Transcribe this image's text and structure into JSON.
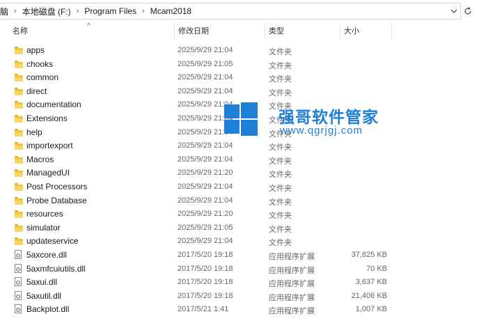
{
  "address_bar": {
    "crumbs": [
      "电脑",
      "本地磁盘 (F:)",
      "Program Files",
      "Mcam2018"
    ],
    "separator": "›",
    "dropdown_icon": "chevron-down-icon",
    "refresh_icon": "refresh-icon"
  },
  "columns": {
    "name": "名称",
    "date": "修改日期",
    "type": "类型",
    "size": "大小",
    "sort_indicator": "^"
  },
  "rows": [
    {
      "kind": "folder",
      "name": "apps",
      "date": "2025/9/29 21:04",
      "type": "文件夹",
      "size": ""
    },
    {
      "kind": "folder",
      "name": "chooks",
      "date": "2025/9/29 21:05",
      "type": "文件夹",
      "size": ""
    },
    {
      "kind": "folder",
      "name": "common",
      "date": "2025/9/29 21:04",
      "type": "文件夹",
      "size": ""
    },
    {
      "kind": "folder",
      "name": "direct",
      "date": "2025/9/29 21:04",
      "type": "文件夹",
      "size": ""
    },
    {
      "kind": "folder",
      "name": "documentation",
      "date": "2025/9/29 21:04",
      "type": "文件夹",
      "size": ""
    },
    {
      "kind": "folder",
      "name": "Extensions",
      "date": "2025/9/29 21:04",
      "type": "文件夹",
      "size": ""
    },
    {
      "kind": "folder",
      "name": "help",
      "date": "2025/9/29 21:04",
      "type": "文件夹",
      "size": ""
    },
    {
      "kind": "folder",
      "name": "importexport",
      "date": "2025/9/29 21:04",
      "type": "文件夹",
      "size": ""
    },
    {
      "kind": "folder",
      "name": "Macros",
      "date": "2025/9/29 21:04",
      "type": "文件夹",
      "size": ""
    },
    {
      "kind": "folder",
      "name": "ManagedUI",
      "date": "2025/9/29 21:20",
      "type": "文件夹",
      "size": ""
    },
    {
      "kind": "folder",
      "name": "Post Processors",
      "date": "2025/9/29 21:04",
      "type": "文件夹",
      "size": ""
    },
    {
      "kind": "folder",
      "name": "Probe Database",
      "date": "2025/9/29 21:04",
      "type": "文件夹",
      "size": ""
    },
    {
      "kind": "folder",
      "name": "resources",
      "date": "2025/9/29 21:20",
      "type": "文件夹",
      "size": ""
    },
    {
      "kind": "folder",
      "name": "simulator",
      "date": "2025/9/29 21:05",
      "type": "文件夹",
      "size": ""
    },
    {
      "kind": "folder",
      "name": "updateservice",
      "date": "2025/9/29 21:04",
      "type": "文件夹",
      "size": ""
    },
    {
      "kind": "file",
      "name": "5axcore.dll",
      "date": "2017/5/20 19:18",
      "type": "应用程序扩展",
      "size": "37,825 KB"
    },
    {
      "kind": "file",
      "name": "5axmfcuiutils.dll",
      "date": "2017/5/20 19:18",
      "type": "应用程序扩展",
      "size": "70 KB"
    },
    {
      "kind": "file",
      "name": "5axui.dll",
      "date": "2017/5/20 19:18",
      "type": "应用程序扩展",
      "size": "3,637 KB"
    },
    {
      "kind": "file",
      "name": "5axutil.dll",
      "date": "2017/5/20 19:18",
      "type": "应用程序扩展",
      "size": "21,406 KB"
    },
    {
      "kind": "file",
      "name": "Backplot.dll",
      "date": "2017/5/21 1:41",
      "type": "应用程序扩展",
      "size": "1,007 KB"
    }
  ],
  "watermark": {
    "title": "强哥软件管家",
    "url": "www.qgrjgj.com",
    "color": "#1e7fd8"
  }
}
